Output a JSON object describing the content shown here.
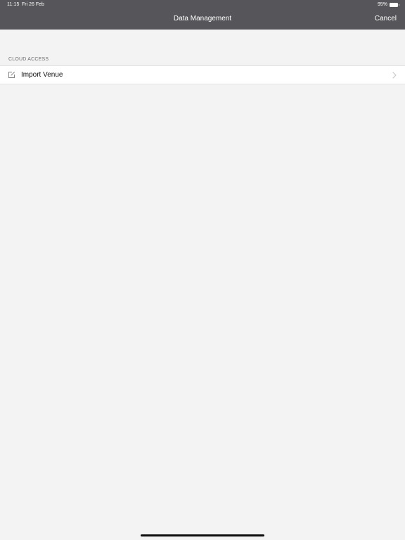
{
  "status_bar": {
    "time": "11:15",
    "date": "Fri 26 Feb",
    "battery": "95%"
  },
  "nav": {
    "title": "Data Management",
    "cancel_label": "Cancel"
  },
  "sections": [
    {
      "header": "CLOUD ACCESS",
      "rows": [
        {
          "label": "Import Venue",
          "icon": "edit-square-icon",
          "accessory": "chevron-right-icon"
        }
      ]
    }
  ],
  "colors": {
    "nav_bar": "#56565a",
    "background": "#f3f3f3",
    "row_background": "#ffffff",
    "section_header_text": "#6d6d72"
  }
}
